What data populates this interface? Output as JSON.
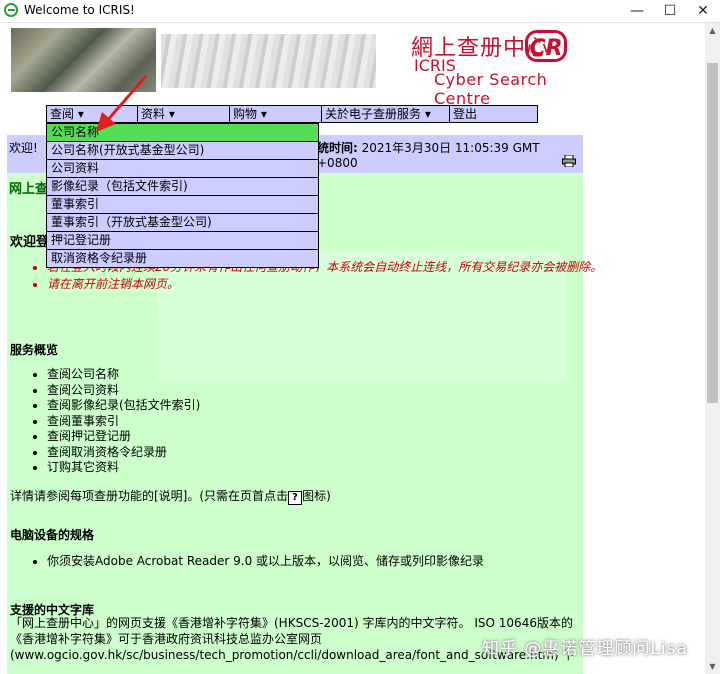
{
  "window": {
    "title": "Welcome to ICRIS!",
    "minimize": "—",
    "maximize": "☐",
    "close": "✕"
  },
  "header": {
    "logo_chinese": "網上查册中心",
    "logo_cr": "CR",
    "logo_icris": "ICRIS",
    "logo_english": "Cyber Search Centre"
  },
  "menu": [
    {
      "label": "查阅 ▾"
    },
    {
      "label": "资料 ▾"
    },
    {
      "label": "购物 ▾"
    },
    {
      "label": "关於电子查册服务 ▾"
    },
    {
      "label": "登出"
    }
  ],
  "dropdown": [
    {
      "label": "公司名称"
    },
    {
      "label": "公司名称(开放式基金型公司)"
    },
    {
      "label": "公司资料"
    },
    {
      "label": "影像纪录（包括文件索引)"
    },
    {
      "label": "董事索引"
    },
    {
      "label": "董事索引（开放式基金型公司)"
    },
    {
      "label": "押记登记册"
    },
    {
      "label": "取消资格令纪录册"
    }
  ],
  "welcome_bar": {
    "greeting": "欢迎!",
    "time_label": "统时间:",
    "time_value": "2021年3月30日 11:05:39 GMT +0800"
  },
  "content": {
    "heading1": "网上查",
    "heading2": "欢迎登",
    "notices": [
      "若在登入时段内连续20分钟未有作出任何查册动作，本系统会自动终止连线，所有交易纪录亦会被删除。",
      "请在离开前注销本网页。"
    ],
    "services_title": "服务概览",
    "services": [
      "查阅公司名称",
      "查阅公司资料",
      "查阅影像纪录(包括文件索引)",
      "查阅董事索引",
      "查阅押记登记册",
      "查阅取消资格令纪录册",
      "订购其它资料"
    ],
    "detail_prefix": "详情请参阅每项查册功能的[说明]。(只需在页首点击",
    "detail_suffix": "图标)",
    "help_icon_char": "?",
    "req_title": "电脑设备的规格",
    "requirements": [
      "你须安装Adobe Acrobat Reader 9.0 或以上版本，以阅览、储存或列印影像纪录"
    ],
    "lib_title": "支援的中文字库",
    "lib_text1": "「网上查册中心」的网页支援《香港增补字符集》(HKSCS-2001) 字库内的中文字符。 ISO 10646版本的",
    "lib_text2": "《香港增补字符集》可于香港政府资讯科技总监办公室网页",
    "lib_text3": "(www.ogcio.gov.hk/sc/business/tech_promotion/ccli/download_area/font_and_software.htm) 下"
  },
  "watermark": "知乎 @惠诺管理顾问Lisa",
  "colors": {
    "menu_bg": "#ccccff",
    "selected": "#55dd55",
    "content_bg": "#ccffcc",
    "brand_red": "#c8102e",
    "annotation_arrow": "#e02020"
  }
}
